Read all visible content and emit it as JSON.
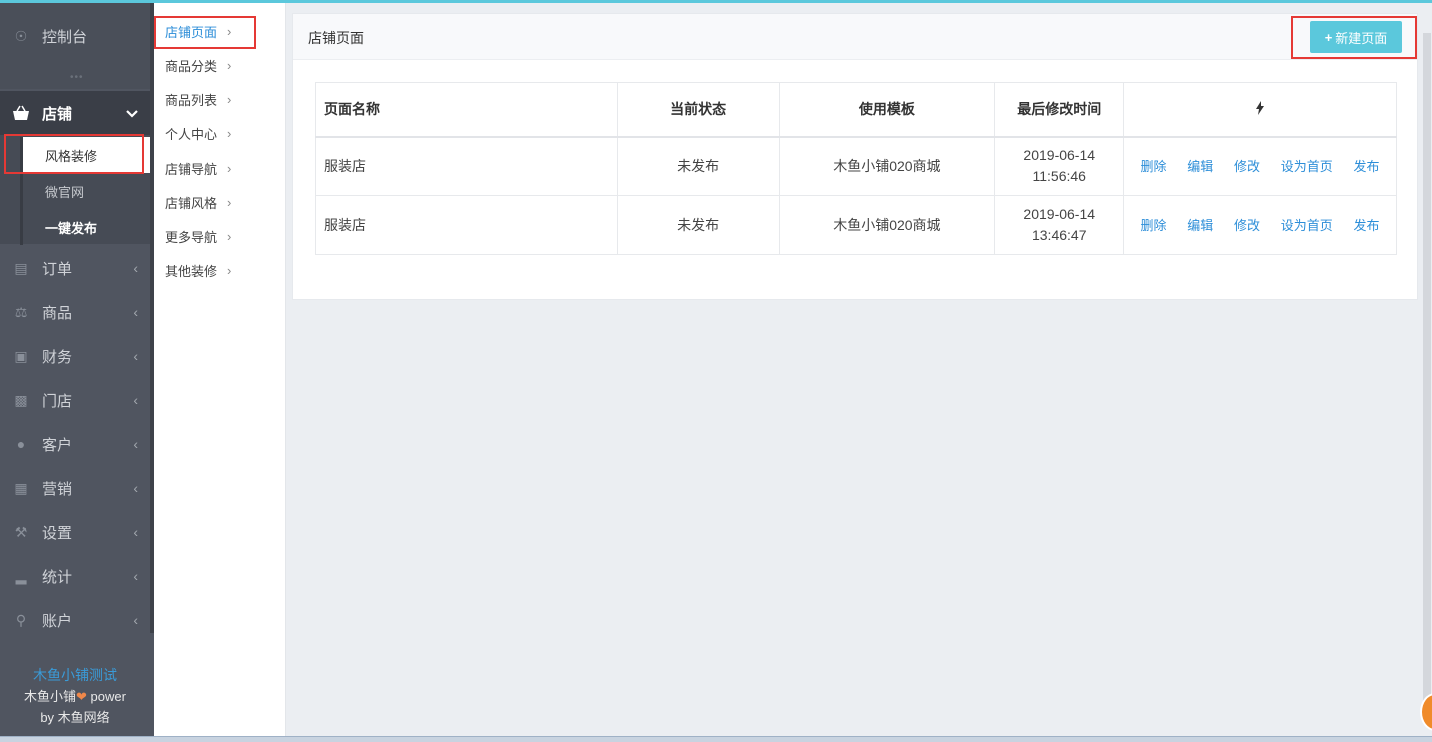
{
  "sidebar": {
    "items": [
      {
        "label": "控制台",
        "icon": "compass-icon"
      },
      {
        "label": "店铺",
        "icon": "basket-icon"
      },
      {
        "label": "订单",
        "icon": "money-icon"
      },
      {
        "label": "商品",
        "icon": "scale-icon"
      },
      {
        "label": "财务",
        "icon": "cash-icon"
      },
      {
        "label": "门店",
        "icon": "sitemap-icon"
      },
      {
        "label": "客户",
        "icon": "users-icon"
      },
      {
        "label": "营销",
        "icon": "gift-icon"
      },
      {
        "label": "设置",
        "icon": "wrench-icon"
      },
      {
        "label": "统计",
        "icon": "signal-icon"
      },
      {
        "label": "账户",
        "icon": "key-icon"
      }
    ],
    "store_sub": [
      "风格装修",
      "微官网",
      "一键发布"
    ],
    "brand": {
      "line1": "木鱼小铺测试",
      "line2_a": "木鱼小铺",
      "line2_b": " power",
      "line3": "by 木鱼网络"
    }
  },
  "subnav": [
    "店铺页面",
    "商品分类",
    "商品列表",
    "个人中心",
    "店铺导航",
    "店铺风格",
    "更多导航",
    "其他装修"
  ],
  "panel": {
    "title": "店铺页面",
    "new_button": "新建页面"
  },
  "table": {
    "headers": [
      "页面名称",
      "当前状态",
      "使用模板",
      "最后修改时间"
    ],
    "rows": [
      {
        "name": "服装店",
        "status": "未发布",
        "template": "木鱼小铺020商城",
        "date": "2019-06-14",
        "time": "11:56:46"
      },
      {
        "name": "服装店",
        "status": "未发布",
        "template": "木鱼小铺020商城",
        "date": "2019-06-14",
        "time": "13:46:47"
      }
    ],
    "ops": [
      "删除",
      "编辑",
      "修改",
      "设为首页",
      "发布"
    ]
  },
  "colors": {
    "accent": "#5bc8dc",
    "link": "#2d8ed8",
    "sidebar": "#505560",
    "highlight": "#e53935"
  }
}
